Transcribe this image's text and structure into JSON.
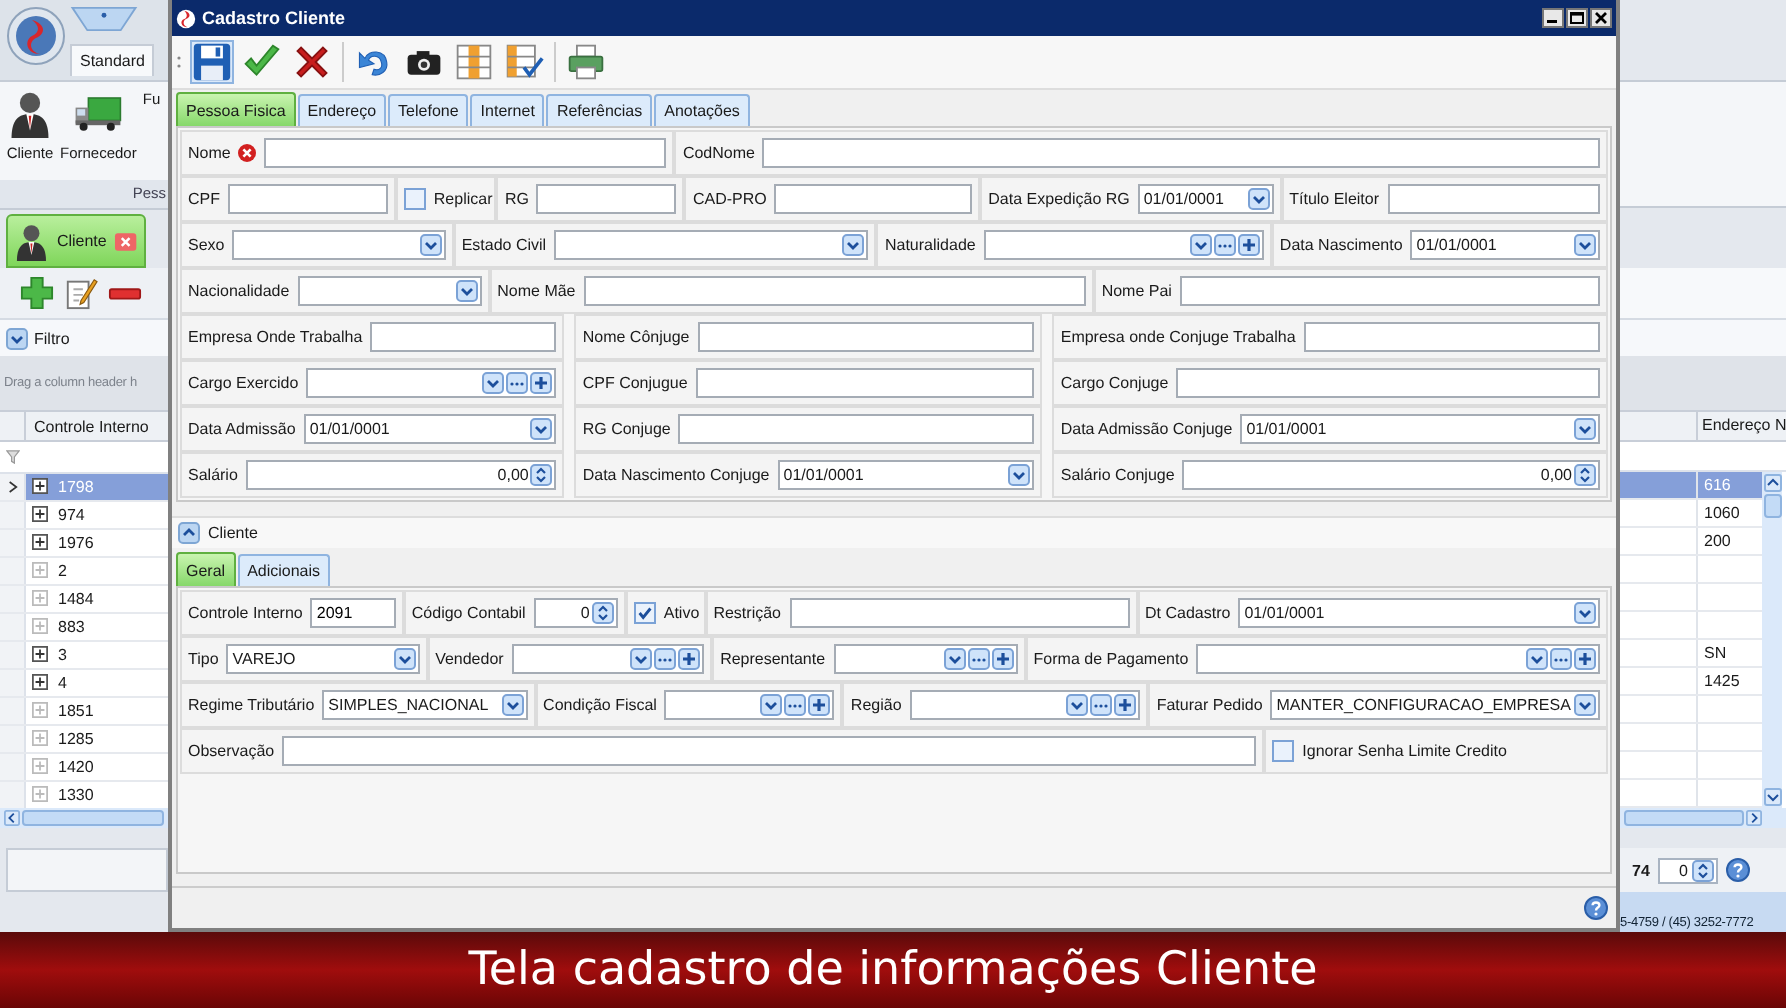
{
  "app": {
    "quick_access_tab": "Standard",
    "ribbon_buttons": [
      {
        "label": "Cliente",
        "kind": "person"
      },
      {
        "label": "Fornecedor",
        "kind": "truck"
      },
      {
        "label": "Fu",
        "kind": "hidden"
      }
    ],
    "ribbon_group": "Pess",
    "document_tab": "Cliente",
    "filter_label": "Filtro",
    "filter_expanded": false,
    "group_panel_hint": "Drag a column header h",
    "columns": [
      "Controle Interno",
      "Endereço N"
    ],
    "rows": [
      {
        "controle": "1798",
        "endereco": "616",
        "selected": true,
        "has_details": true
      },
      {
        "controle": "974",
        "endereco": "1060",
        "selected": false,
        "has_details": true
      },
      {
        "controle": "1976",
        "endereco": "200",
        "selected": false,
        "has_details": true
      },
      {
        "controle": "2",
        "selected": false,
        "has_details": false
      },
      {
        "controle": "1484",
        "selected": false,
        "has_details": false
      },
      {
        "controle": "883",
        "selected": false,
        "has_details": false
      },
      {
        "controle": "3",
        "endereco": "SN",
        "selected": false,
        "has_details": true
      },
      {
        "controle": "4",
        "endereco": "1425",
        "selected": false,
        "has_details": true
      },
      {
        "controle": "1851",
        "selected": false,
        "has_details": false
      },
      {
        "controle": "1285",
        "selected": false,
        "has_details": false
      },
      {
        "controle": "1420",
        "selected": false,
        "has_details": false
      },
      {
        "controle": "1330",
        "selected": false,
        "has_details": false
      }
    ],
    "record_count": "74",
    "page_spinner": "0",
    "status_text": "5-4759 / (45) 3252-7772"
  },
  "dialog": {
    "title": "Cadastro Cliente",
    "tabs": [
      {
        "label": "Pessoa Fisica",
        "selected": true
      },
      {
        "label": "Endereço",
        "selected": false
      },
      {
        "label": "Telefone",
        "selected": false
      },
      {
        "label": "Internet",
        "selected": false
      },
      {
        "label": "Referências",
        "selected": false
      },
      {
        "label": "Anotações",
        "selected": false
      }
    ],
    "person_rows": [
      [
        {
          "label": "Nome",
          "kind": "text",
          "invalid": true
        },
        {
          "label": "CodNome",
          "kind": "text"
        }
      ],
      [
        {
          "label": "CPF",
          "kind": "text"
        },
        {
          "label": "Replicar",
          "kind": "checkbox",
          "checked": false
        },
        {
          "label": "RG",
          "kind": "text"
        },
        {
          "label": "CAD-PRO",
          "kind": "text"
        },
        {
          "label": "Data Expedição RG",
          "kind": "date",
          "value": "01/01/0001"
        },
        {
          "label": "Título Eleitor",
          "kind": "text"
        }
      ],
      [
        {
          "label": "Sexo",
          "kind": "select"
        },
        {
          "label": "Estado Civil",
          "kind": "select"
        },
        {
          "label": "Naturalidade",
          "kind": "lookup"
        },
        {
          "label": "Data Nascimento",
          "kind": "date",
          "value": "01/01/0001"
        }
      ],
      [
        {
          "label": "Nacionalidade",
          "kind": "select"
        },
        {
          "label": "Nome Mãe",
          "kind": "text"
        },
        {
          "label": "Nome Pai",
          "kind": "text"
        }
      ]
    ],
    "person_columns": [
      [
        {
          "label": "Empresa Onde Trabalha",
          "kind": "text"
        },
        {
          "label": "Cargo Exercido",
          "kind": "lookup"
        },
        {
          "label": "Data Admissão",
          "kind": "date",
          "value": "01/01/0001"
        },
        {
          "label": "Salário",
          "kind": "spin",
          "value": "0,00"
        }
      ],
      [
        {
          "label": "Nome Cônjuge",
          "kind": "text"
        },
        {
          "label": "CPF Conjugue",
          "kind": "text"
        },
        {
          "label": "RG Conjuge",
          "kind": "text"
        },
        {
          "label": "Data Nascimento Conjuge",
          "kind": "date",
          "value": "01/01/0001"
        }
      ],
      [
        {
          "label": "Empresa onde Conjuge Trabalha",
          "kind": "text"
        },
        {
          "label": "Cargo Conjuge",
          "kind": "text"
        },
        {
          "label": "Data Admissão Conjuge",
          "kind": "date",
          "value": "01/01/0001"
        },
        {
          "label": "Salário Conjuge",
          "kind": "spin",
          "value": "0,00"
        }
      ]
    ],
    "client_section": {
      "title": "Cliente",
      "expanded": true,
      "tabs": [
        {
          "label": "Geral",
          "selected": true
        },
        {
          "label": "Adicionais",
          "selected": false
        }
      ],
      "rows": [
        [
          {
            "label": "Controle Interno",
            "kind": "text",
            "value": "2091"
          },
          {
            "label": "Código Contabil",
            "kind": "spin",
            "value": "0"
          },
          {
            "label": "Ativo",
            "kind": "checkbox",
            "checked": true
          },
          {
            "label": "Restrição",
            "kind": "text"
          },
          {
            "label": "Dt Cadastro",
            "kind": "date",
            "value": "01/01/0001"
          }
        ],
        [
          {
            "label": "Tipo",
            "kind": "select",
            "value": "VAREJO"
          },
          {
            "label": "Vendedor",
            "kind": "lookup"
          },
          {
            "label": "Representante",
            "kind": "lookup"
          },
          {
            "label": "Forma de Pagamento",
            "kind": "lookup"
          }
        ],
        [
          {
            "label": "Regime Tributário",
            "kind": "select",
            "value": "SIMPLES_NACIONAL"
          },
          {
            "label": "Condição Fiscal",
            "kind": "lookup"
          },
          {
            "label": "Região",
            "kind": "lookup"
          },
          {
            "label": "Faturar Pedido",
            "kind": "select",
            "value": "MANTER_CONFIGURACAO_EMPRESA"
          }
        ],
        [
          {
            "label": "Observação",
            "kind": "text"
          },
          {
            "label": "Ignorar Senha Limite Credito",
            "kind": "checkbox",
            "checked": false
          }
        ]
      ]
    }
  },
  "caption": "Tela cadastro de informações Cliente"
}
